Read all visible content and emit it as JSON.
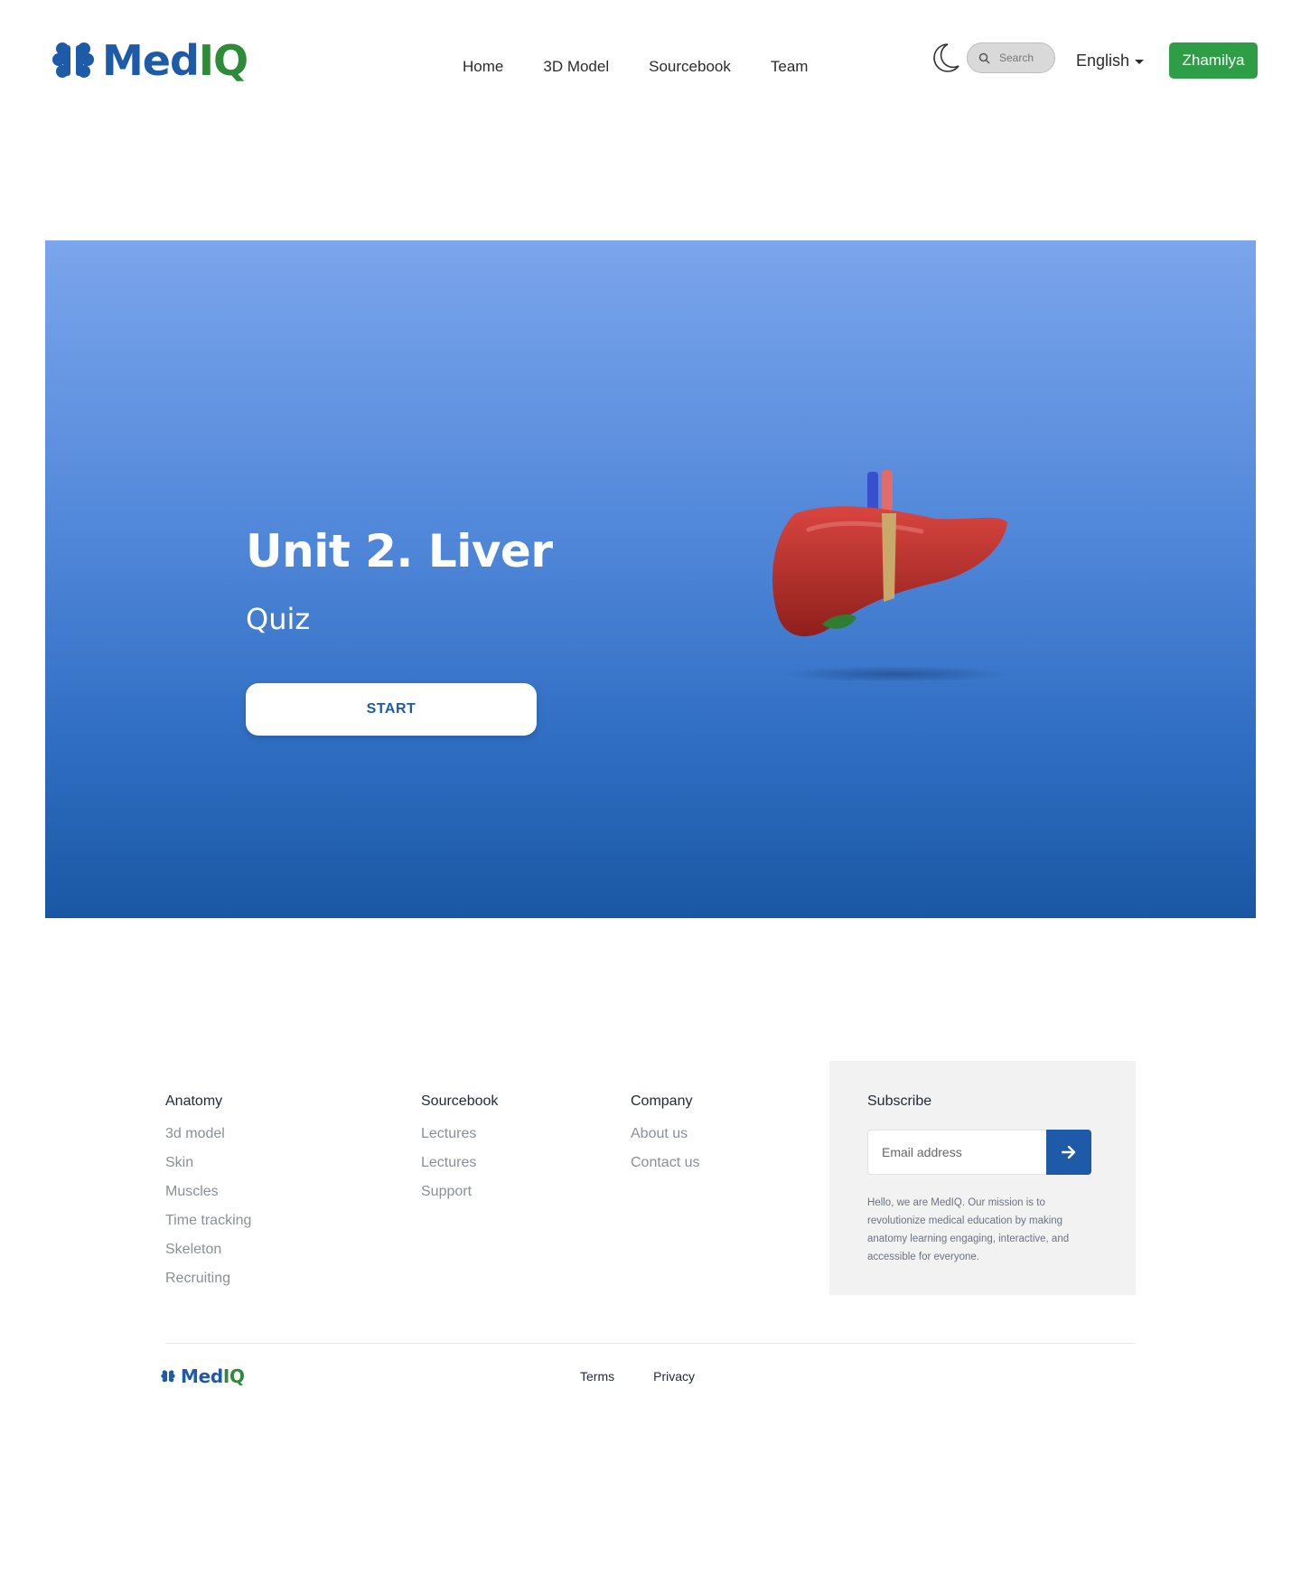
{
  "header": {
    "logo": {
      "part1": "Med",
      "part2": "IQ"
    },
    "nav": [
      "Home",
      "3D Model",
      "Sourcebook",
      "Team"
    ],
    "search_placeholder": "Search",
    "language": "English",
    "user": "Zhamilya"
  },
  "hero": {
    "title": "Unit 2. Liver",
    "subtitle": "Quiz",
    "start_label": "START"
  },
  "footer": {
    "columns": [
      {
        "title": "Anatomy",
        "links": [
          "3d model",
          "Skin",
          "Muscles",
          "Time tracking",
          "Skeleton",
          "Recruiting"
        ]
      },
      {
        "title": "Sourcebook",
        "links": [
          "Lectures",
          "Lectures",
          "Support"
        ]
      },
      {
        "title": "Company",
        "links": [
          "About us",
          "Contact us"
        ]
      }
    ],
    "subscribe": {
      "title": "Subscribe",
      "placeholder": "Email address",
      "description": "Hello, we are MedIQ. Our mission is to revolutionize medical education by making anatomy learning engaging, interactive, and accessible for everyone."
    },
    "bottom_links": [
      "Terms",
      "Privacy"
    ]
  },
  "colors": {
    "brand_blue": "#1d5aa8",
    "brand_green": "#2e8b3a",
    "user_button": "#2e9e46",
    "hero_top": "#7ba5ec",
    "hero_bottom": "#1a57a3"
  },
  "icons": [
    "brain-logo-icon",
    "moon-icon",
    "search-icon",
    "caret-down-icon",
    "arrow-right-icon",
    "liver-illustration"
  ]
}
